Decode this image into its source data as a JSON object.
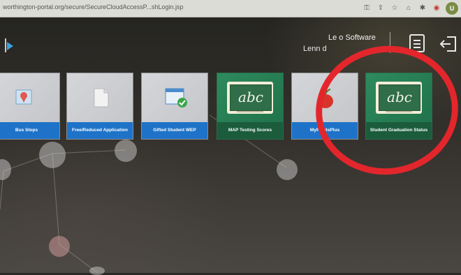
{
  "browser": {
    "url": "worthington-portal.org/secure/SecureCloudAccessP...shLogin.jsp",
    "avatar_letter": "U",
    "icons": [
      "key-icon",
      "share-icon",
      "star-icon",
      "extension-icon",
      "puzzle-icon",
      "extension-red-icon"
    ]
  },
  "header": {
    "title": "Le   o Software",
    "subtitle": "Lenn          d"
  },
  "tiles": [
    {
      "label": "Bus Stops",
      "icon": "map-pin-icon",
      "theme": "gray"
    },
    {
      "label": "Free/Reduced Application",
      "icon": "document-icon",
      "theme": "gray"
    },
    {
      "label": "Gifted Student WEP",
      "icon": "checked-window-icon",
      "theme": "gray"
    },
    {
      "label": "MAP Testing Scores",
      "icon": "chalkboard-icon",
      "board_text": "abc",
      "theme": "green"
    },
    {
      "label": "MyP      entsPlus",
      "icon": "apple-icon",
      "theme": "gray"
    },
    {
      "label": "Student Graduation Status",
      "icon": "chalkboard-icon",
      "board_text": "abc",
      "theme": "green"
    }
  ],
  "colors": {
    "tile_label_blue": "#1e73c8",
    "tile_green": "#2e8a5e",
    "annotation_red": "#e3262c",
    "logo_accent": "#3aa3e0"
  }
}
